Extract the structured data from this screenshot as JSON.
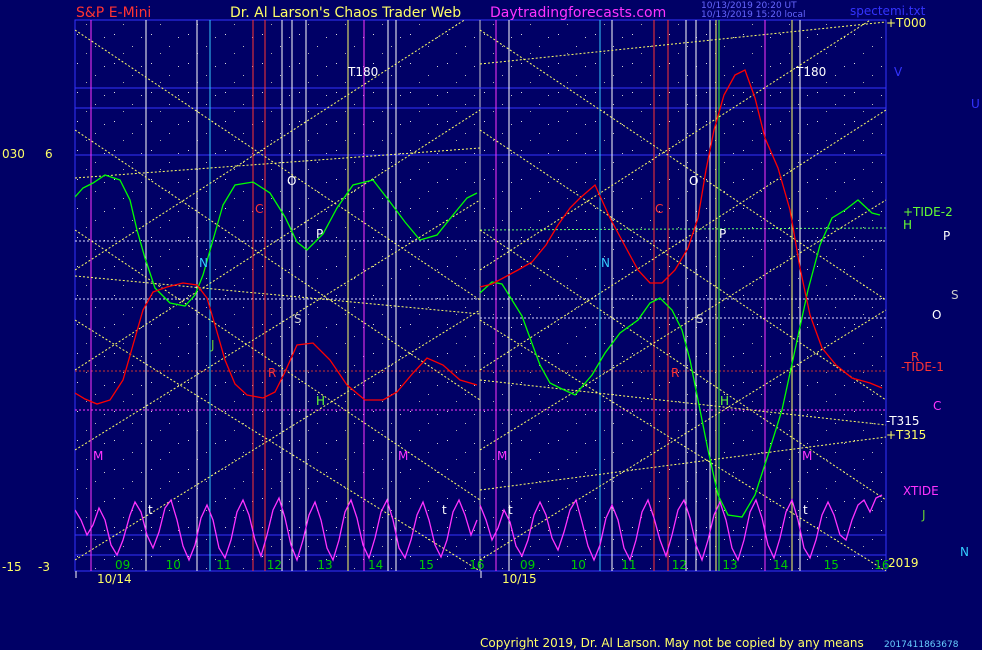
{
  "header": {
    "left": "S&P E-Mini",
    "center": "Dr. Al Larson's Chaos Trader Web",
    "site": "Daytradingforecasts.com",
    "right": "spectemi.txt",
    "stamp1": "10/13/2019 20:20 UT",
    "stamp2": "10/13/2019 15:20 local"
  },
  "footer": {
    "copyright": "Copyright 2019, Dr. Al Larson. May not be copied by any means",
    "code": "2017411863678"
  },
  "y_labels": {
    "top_left": "030",
    "top_value": "6",
    "bottom_left": "-15",
    "bottom_value": "-3",
    "year": "2019"
  },
  "right_labels": {
    "t000": "+T000",
    "v": "V",
    "u": "U",
    "tide2": "+TIDE-2",
    "h": "H",
    "p": "P",
    "s": "S",
    "o": "O",
    "r": "R",
    "tide1": "-TIDE-1",
    "c": "C",
    "mt315": "-T315",
    "pt315": "+T315",
    "xtide": "XTIDE",
    "j": "J",
    "n": "N"
  },
  "chart_data": {
    "type": "line",
    "title": "S&P E-Mini",
    "days": [
      "10/14",
      "10/15"
    ],
    "x_ticks": [
      {
        "day": "10/14",
        "hours": [
          "09",
          "10",
          "11",
          "12",
          "13",
          "14",
          "15",
          "16"
        ]
      },
      {
        "day": "10/15",
        "hours": [
          "09",
          "10",
          "11",
          "12",
          "13",
          "14",
          "15",
          "16"
        ]
      }
    ],
    "ylim": [
      -15,
      30
    ],
    "series": [
      {
        "name": "+TIDE-2",
        "color": "#00ff00",
        "values": [
          [
            [
              0,
              197
            ],
            [
              8,
              188
            ],
            [
              18,
              183
            ],
            [
              30,
              175
            ],
            [
              45,
              180
            ],
            [
              55,
              200
            ],
            [
              62,
              230
            ],
            [
              70,
              258
            ],
            [
              80,
              288
            ],
            [
              95,
              303
            ],
            [
              110,
              306
            ],
            [
              120,
              295
            ],
            [
              128,
              275
            ],
            [
              138,
              240
            ],
            [
              148,
              205
            ],
            [
              160,
              185
            ],
            [
              178,
              182
            ],
            [
              195,
              193
            ],
            [
              210,
              217
            ],
            [
              222,
              242
            ],
            [
              232,
              250
            ],
            [
              248,
              234
            ],
            [
              262,
              208
            ],
            [
              278,
              185
            ],
            [
              298,
              180
            ],
            [
              312,
              198
            ],
            [
              330,
              222
            ],
            [
              345,
              240
            ],
            [
              362,
              235
            ],
            [
              378,
              215
            ],
            [
              392,
              198
            ],
            [
              402,
              193
            ]
          ],
          [
            [
              0,
              293
            ],
            [
              12,
              282
            ],
            [
              22,
              284
            ],
            [
              32,
              300
            ],
            [
              42,
              316
            ],
            [
              50,
              338
            ],
            [
              60,
              365
            ],
            [
              70,
              383
            ],
            [
              80,
              388
            ],
            [
              95,
              395
            ],
            [
              112,
              375
            ],
            [
              125,
              353
            ],
            [
              140,
              333
            ],
            [
              158,
              320
            ],
            [
              170,
              303
            ],
            [
              180,
              298
            ],
            [
              192,
              310
            ],
            [
              202,
              330
            ],
            [
              210,
              360
            ],
            [
              218,
              400
            ],
            [
              228,
              450
            ],
            [
              238,
              495
            ],
            [
              248,
              515
            ],
            [
              262,
              517
            ],
            [
              275,
              495
            ],
            [
              288,
              455
            ],
            [
              302,
              410
            ],
            [
              315,
              350
            ],
            [
              328,
              290
            ],
            [
              340,
              245
            ],
            [
              352,
              218
            ],
            [
              365,
              210
            ],
            [
              378,
              200
            ],
            [
              392,
              213
            ],
            [
              400,
              215
            ]
          ]
        ]
      },
      {
        "name": "-TIDE-1",
        "color": "#ff0000",
        "values": [
          [
            [
              0,
              393
            ],
            [
              10,
              399
            ],
            [
              22,
              404
            ],
            [
              35,
              400
            ],
            [
              48,
              380
            ],
            [
              58,
              345
            ],
            [
              68,
              310
            ],
            [
              78,
              292
            ],
            [
              92,
              287
            ],
            [
              108,
              283
            ],
            [
              122,
              285
            ],
            [
              132,
              298
            ],
            [
              140,
              325
            ],
            [
              150,
              360
            ],
            [
              160,
              384
            ],
            [
              172,
              395
            ],
            [
              188,
              398
            ],
            [
              200,
              392
            ],
            [
              210,
              372
            ],
            [
              222,
              345
            ],
            [
              238,
              343
            ],
            [
              255,
              360
            ],
            [
              272,
              385
            ],
            [
              290,
              400
            ],
            [
              308,
              400
            ],
            [
              322,
              392
            ],
            [
              338,
              373
            ],
            [
              352,
              358
            ],
            [
              368,
              365
            ],
            [
              385,
              380
            ],
            [
              402,
              385
            ]
          ],
          [
            [
              0,
              287
            ],
            [
              12,
              284
            ],
            [
              25,
              277
            ],
            [
              38,
              270
            ],
            [
              52,
              262
            ],
            [
              66,
              245
            ],
            [
              78,
              225
            ],
            [
              90,
              208
            ],
            [
              100,
              198
            ],
            [
              115,
              185
            ],
            [
              130,
              218
            ],
            [
              145,
              246
            ],
            [
              158,
              270
            ],
            [
              170,
              283
            ],
            [
              182,
              283
            ],
            [
              195,
              270
            ],
            [
              208,
              248
            ],
            [
              218,
              218
            ],
            [
              226,
              170
            ],
            [
              234,
              130
            ],
            [
              244,
              95
            ],
            [
              255,
              75
            ],
            [
              265,
              70
            ],
            [
              275,
              98
            ],
            [
              285,
              138
            ],
            [
              298,
              168
            ],
            [
              310,
              210
            ],
            [
              320,
              268
            ],
            [
              330,
              315
            ],
            [
              342,
              348
            ],
            [
              356,
              365
            ],
            [
              372,
              378
            ],
            [
              390,
              383
            ],
            [
              402,
              388
            ]
          ]
        ]
      },
      {
        "name": "XTIDE",
        "color": "#ff33ff",
        "values": [
          [
            [
              0,
              510
            ],
            [
              6,
              520
            ],
            [
              12,
              535
            ],
            [
              18,
              525
            ],
            [
              24,
              508
            ],
            [
              30,
              520
            ],
            [
              36,
              545
            ],
            [
              42,
              555
            ],
            [
              48,
              540
            ],
            [
              55,
              515
            ],
            [
              60,
              502
            ],
            [
              66,
              512
            ],
            [
              72,
              535
            ],
            [
              78,
              548
            ],
            [
              84,
              532
            ],
            [
              90,
              508
            ],
            [
              96,
              500
            ],
            [
              102,
              520
            ],
            [
              108,
              546
            ],
            [
              114,
              560
            ],
            [
              120,
              545
            ],
            [
              126,
              518
            ],
            [
              132,
              505
            ],
            [
              138,
              520
            ],
            [
              144,
              548
            ],
            [
              150,
              558
            ],
            [
              156,
              540
            ],
            [
              162,
              512
            ],
            [
              168,
              500
            ],
            [
              174,
              515
            ],
            [
              180,
              540
            ],
            [
              186,
              556
            ],
            [
              192,
              535
            ],
            [
              198,
              510
            ],
            [
              204,
              498
            ],
            [
              210,
              518
            ],
            [
              216,
              545
            ],
            [
              222,
              560
            ],
            [
              228,
              540
            ],
            [
              234,
              515
            ],
            [
              240,
              502
            ],
            [
              246,
              520
            ],
            [
              252,
              548
            ],
            [
              258,
              560
            ],
            [
              264,
              540
            ],
            [
              270,
              512
            ],
            [
              276,
              500
            ],
            [
              282,
              518
            ],
            [
              288,
              545
            ],
            [
              294,
              558
            ],
            [
              300,
              538
            ],
            [
              306,
              512
            ],
            [
              312,
              500
            ],
            [
              318,
              520
            ],
            [
              324,
              548
            ],
            [
              330,
              558
            ],
            [
              336,
              540
            ],
            [
              342,
              515
            ],
            [
              348,
              502
            ],
            [
              354,
              520
            ],
            [
              360,
              545
            ],
            [
              366,
              557
            ],
            [
              372,
              540
            ],
            [
              378,
              512
            ],
            [
              384,
              500
            ],
            [
              390,
              515
            ],
            [
              396,
              535
            ],
            [
              402,
              520
            ]
          ],
          [
            [
              0,
              505
            ],
            [
              6,
              520
            ],
            [
              12,
              540
            ],
            [
              18,
              528
            ],
            [
              24,
              510
            ],
            [
              30,
              522
            ],
            [
              36,
              546
            ],
            [
              42,
              556
            ],
            [
              48,
              540
            ],
            [
              54,
              515
            ],
            [
              60,
              502
            ],
            [
              66,
              515
            ],
            [
              72,
              538
            ],
            [
              78,
              550
            ],
            [
              84,
              532
            ],
            [
              90,
              510
            ],
            [
              96,
              500
            ],
            [
              102,
              522
            ],
            [
              108,
              546
            ],
            [
              114,
              560
            ],
            [
              120,
              545
            ],
            [
              126,
              518
            ],
            [
              132,
              505
            ],
            [
              138,
              520
            ],
            [
              144,
              548
            ],
            [
              150,
              560
            ],
            [
              156,
              540
            ],
            [
              162,
              512
            ],
            [
              168,
              500
            ],
            [
              174,
              518
            ],
            [
              180,
              540
            ],
            [
              186,
              556
            ],
            [
              192,
              535
            ],
            [
              198,
              510
            ],
            [
              204,
              500
            ],
            [
              210,
              518
            ],
            [
              216,
              545
            ],
            [
              222,
              560
            ],
            [
              228,
              540
            ],
            [
              234,
              515
            ],
            [
              240,
              502
            ],
            [
              246,
              520
            ],
            [
              252,
              548
            ],
            [
              258,
              560
            ],
            [
              264,
              540
            ],
            [
              270,
              512
            ],
            [
              276,
              500
            ],
            [
              282,
              518
            ],
            [
              288,
              545
            ],
            [
              294,
              558
            ],
            [
              300,
              538
            ],
            [
              306,
              512
            ],
            [
              312,
              500
            ],
            [
              318,
              520
            ],
            [
              324,
              548
            ],
            [
              330,
              558
            ],
            [
              336,
              540
            ],
            [
              342,
              515
            ],
            [
              348,
              502
            ],
            [
              354,
              515
            ],
            [
              360,
              535
            ],
            [
              366,
              540
            ],
            [
              372,
              520
            ],
            [
              378,
              505
            ],
            [
              384,
              500
            ],
            [
              390,
              512
            ],
            [
              396,
              498
            ],
            [
              402,
              495
            ]
          ]
        ]
      }
    ],
    "point_labels": [
      "O",
      "C",
      "P",
      "N",
      "S",
      "J",
      "R",
      "H",
      "M",
      "M",
      "T180",
      "t"
    ],
    "colors": {
      "background": "#000066",
      "frame": "#3333ff",
      "grid": "#cccccc",
      "diagonal": "#ffff66",
      "tide2": "#00ff00",
      "tide1": "#ff0000",
      "xtide": "#ff33ff"
    },
    "grid": true
  }
}
